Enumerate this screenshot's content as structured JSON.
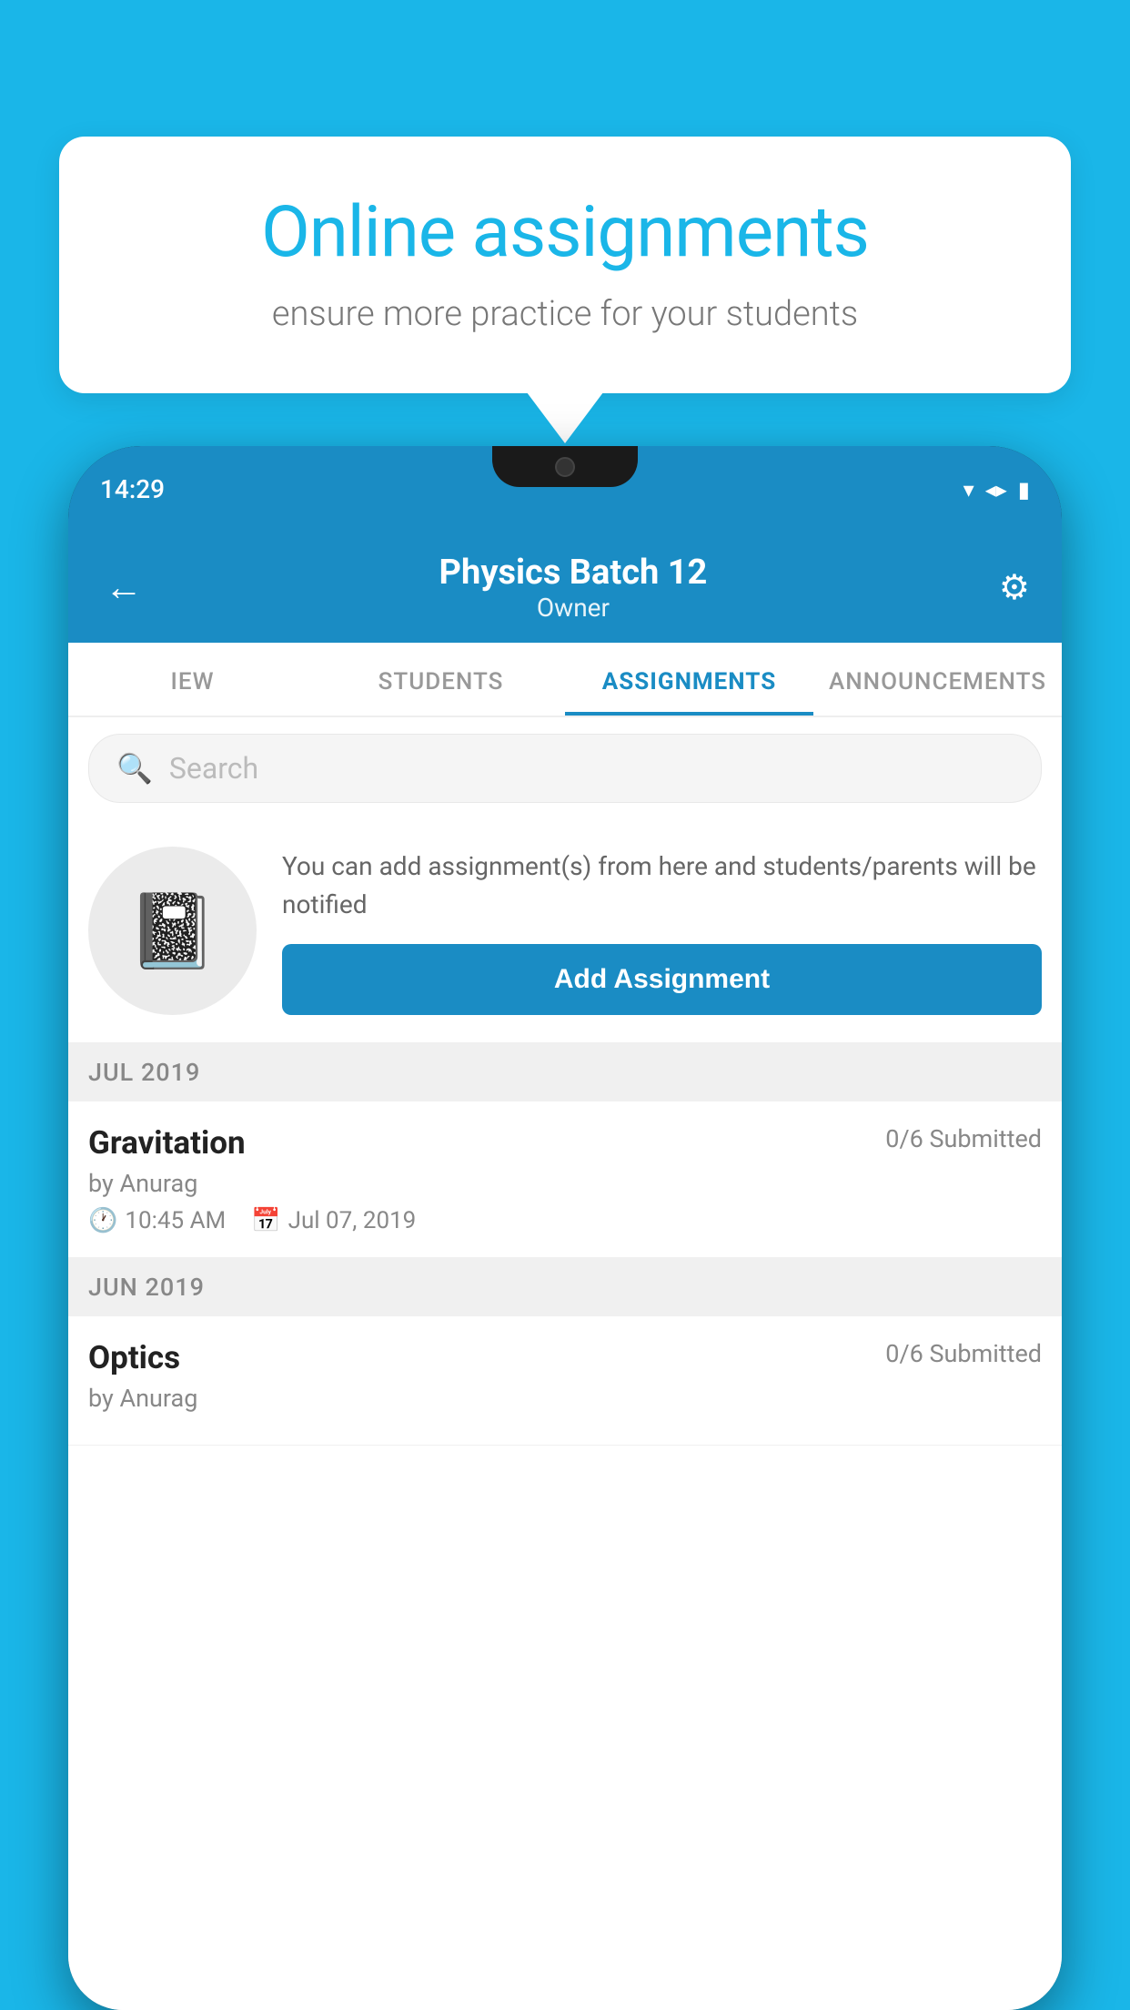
{
  "background_color": "#1ab6e8",
  "speech_bubble": {
    "title": "Online assignments",
    "subtitle": "ensure more practice for your students"
  },
  "status_bar": {
    "time": "14:29",
    "wifi": "▼",
    "signal": "▲",
    "battery": "▮"
  },
  "header": {
    "title": "Physics Batch 12",
    "subtitle": "Owner",
    "back_label": "←",
    "settings_label": "⚙"
  },
  "tabs": [
    {
      "label": "IEW",
      "active": false
    },
    {
      "label": "STUDENTS",
      "active": false
    },
    {
      "label": "ASSIGNMENTS",
      "active": true
    },
    {
      "label": "ANNOUNCEMENTS",
      "active": false
    }
  ],
  "search": {
    "placeholder": "Search"
  },
  "promo": {
    "description": "You can add assignment(s) from here and students/parents will be notified",
    "button_label": "Add Assignment"
  },
  "sections": [
    {
      "month": "JUL 2019",
      "assignments": [
        {
          "title": "Gravitation",
          "submitted": "0/6 Submitted",
          "author": "by Anurag",
          "time": "10:45 AM",
          "date": "Jul 07, 2019"
        }
      ]
    },
    {
      "month": "JUN 2019",
      "assignments": [
        {
          "title": "Optics",
          "submitted": "0/6 Submitted",
          "author": "by Anurag",
          "time": "",
          "date": ""
        }
      ]
    }
  ]
}
